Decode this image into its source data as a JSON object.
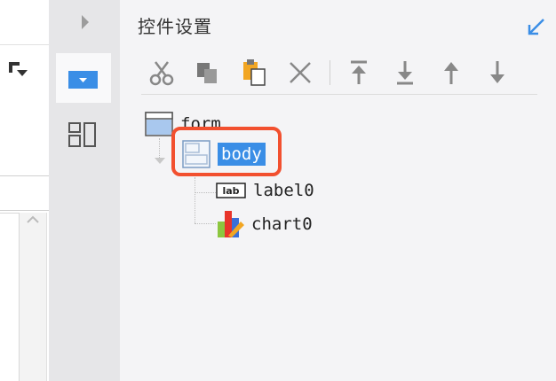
{
  "panel": {
    "title": "控件设置"
  },
  "toolbar": {
    "buttons": [
      {
        "name": "cut",
        "icon": "scissors-icon"
      },
      {
        "name": "copy",
        "icon": "copy-icon"
      },
      {
        "name": "paste",
        "icon": "paste-icon"
      },
      {
        "name": "delete",
        "icon": "close-icon"
      },
      {
        "name": "move-top",
        "icon": "arrow-top-icon"
      },
      {
        "name": "move-bottom",
        "icon": "arrow-bottom-icon"
      },
      {
        "name": "move-up",
        "icon": "arrow-up-icon"
      },
      {
        "name": "move-down",
        "icon": "arrow-down-icon"
      }
    ]
  },
  "tree": {
    "root": "form",
    "body": "body",
    "children": [
      "label0",
      "chart0"
    ],
    "label_icon_text": "lab"
  },
  "colors": {
    "accent": "#3a8ee6",
    "highlight": "#f2502f"
  }
}
